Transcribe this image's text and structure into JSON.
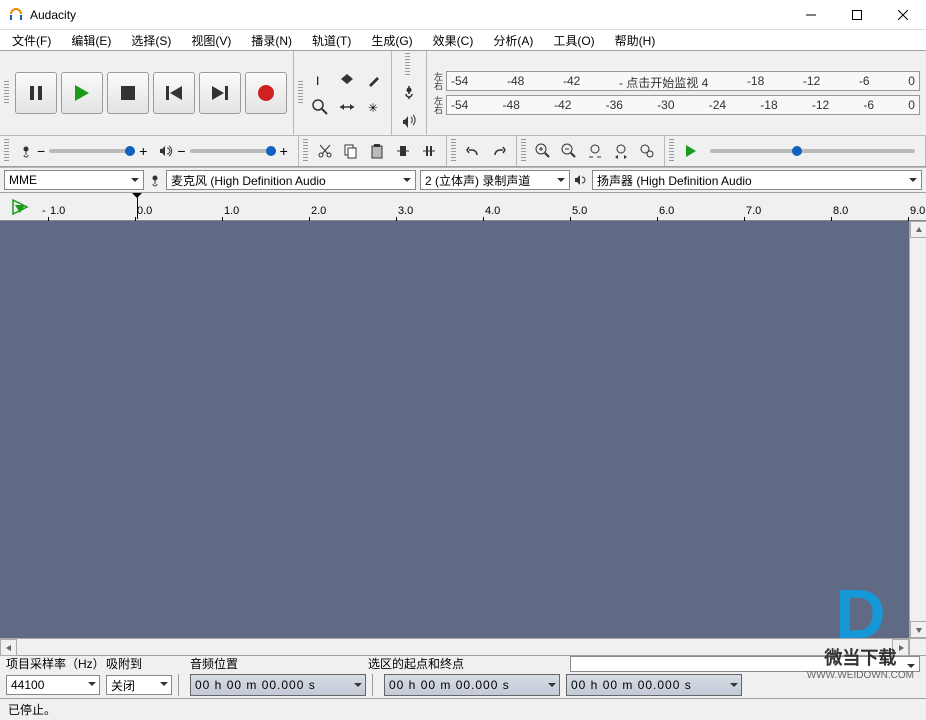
{
  "window": {
    "title": "Audacity"
  },
  "menu": [
    "文件(F)",
    "编辑(E)",
    "选择(S)",
    "视图(V)",
    "播录(N)",
    "轨道(T)",
    "生成(G)",
    "效果(C)",
    "分析(A)",
    "工具(O)",
    "帮助(H)"
  ],
  "meter": {
    "lr": "左右",
    "ticks": [
      "-54",
      "-48",
      "-42",
      "-36",
      "-30",
      "-24",
      "-18",
      "-12",
      "-6",
      "0"
    ],
    "rec_ticks": [
      "-54",
      "-48",
      "-42",
      "- 点击开始监视 4",
      "-18",
      "-12",
      "-6",
      "0"
    ]
  },
  "devices": {
    "host": "MME",
    "input": "麦克风 (High Definition Audio",
    "channels": "2 (立体声) 录制声道",
    "output": "扬声器 (High Definition Audio"
  },
  "timeline": {
    "marks": [
      "1.0",
      "0.0",
      "1.0",
      "2.0",
      "3.0",
      "4.0",
      "5.0",
      "6.0",
      "7.0",
      "8.0",
      "9.0"
    ]
  },
  "bottom": {
    "rate_label": "项目采样率（Hz）",
    "rate_value": "44100",
    "snap_label": "吸附到",
    "snap_value": "关闭",
    "pos_label": "音频位置",
    "pos_value": "00 h 00 m 00.000 s",
    "sel_label": "选区的起点和终点",
    "sel_start": "00 h 00 m 00.000 s",
    "sel_end": "00 h 00 m 00.000 s"
  },
  "status": "已停止。",
  "watermark": {
    "brand": "微当下载",
    "url": "WWW.WEIDOWN.COM"
  }
}
